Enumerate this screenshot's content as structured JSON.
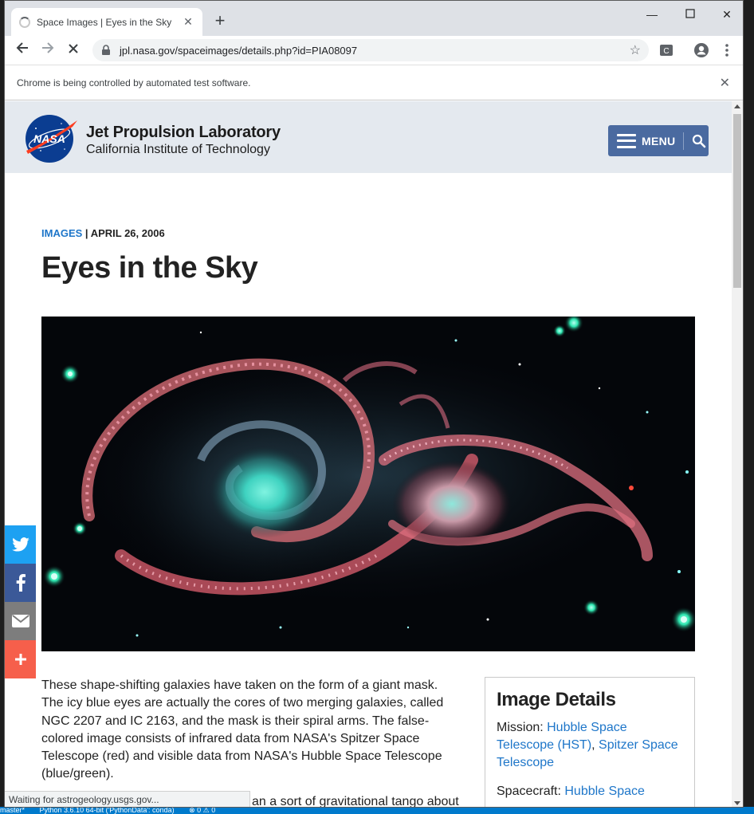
{
  "browser": {
    "tab_title": "Space Images | Eyes in the Sky",
    "url": "jpl.nasa.gov/spaceimages/details.php?id=PIA08097",
    "infobar_message": "Chrome is being controlled by automated test software.",
    "status_text": "Waiting for astrogeology.usgs.gov..."
  },
  "desktop": {
    "status_items": [
      "master*",
      "Python 3.6.10 64-bit ('PythonData': conda)",
      "⊗ 0 ⚠ 0"
    ]
  },
  "header": {
    "title": "Jet Propulsion Laboratory",
    "subtitle": "California Institute of Technology",
    "logo_text": "NASA",
    "menu_label": "MENU"
  },
  "article": {
    "category": "IMAGES",
    "separator": " | ",
    "date": "APRIL 26, 2006",
    "title": "Eyes in the Sky",
    "paragraph": "These shape-shifting galaxies have taken on the form of a giant mask. The icy blue eyes are actually the cores of two merging galaxies, called NGC 2207 and IC 2163, and the mask is their spiral arms. The false-colored image consists of infrared data from NASA's Spitzer Space Telescope (red) and visible data from NASA's Hubble Space Telescope (blue/green).",
    "paragraph2_partial": "an a sort of gravitational tango about"
  },
  "details": {
    "heading": "Image Details",
    "mission_label": "Mission: ",
    "mission_link1": "Hubble Space Telescope (HST)",
    "mission_sep": ", ",
    "mission_link2": "Spitzer Space Telescope",
    "spacecraft_label": "Spacecraft: ",
    "spacecraft_link": "Hubble Space"
  },
  "share": [
    {
      "name": "twitter",
      "icon": "twitter-icon",
      "color": "#1da1f2"
    },
    {
      "name": "facebook",
      "icon": "facebook-icon",
      "color": "#3b5998"
    },
    {
      "name": "email",
      "icon": "email-icon",
      "color": "#7d7d7d"
    },
    {
      "name": "more",
      "icon": "plus-icon",
      "color": "#f65f4b"
    }
  ],
  "colors": {
    "header_bg": "#e4e9ef",
    "menu_button": "#4a6aa0",
    "link": "#1e76c9"
  }
}
